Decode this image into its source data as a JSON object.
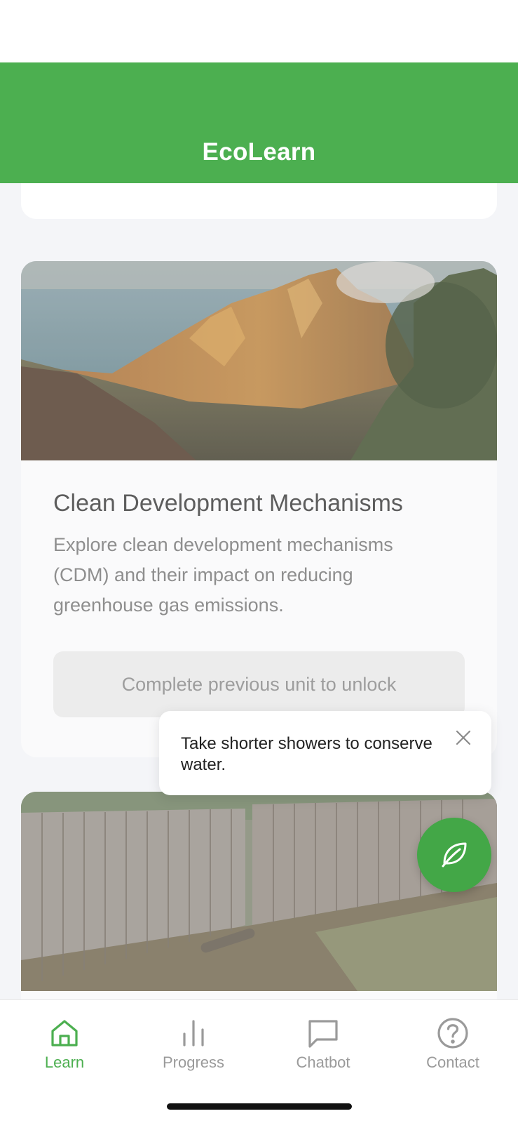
{
  "app": {
    "title": "EcoLearn",
    "brand_color": "#4caf50"
  },
  "units": [
    {
      "title": "Clean Development Mechanisms",
      "description": "Explore clean development mechanisms (CDM) and their impact on reducing greenhouse gas emissions.",
      "button_label": "Complete previous unit to unlock",
      "locked": true,
      "image": "coastal-mountain-valley"
    },
    {
      "image": "wooden-fence-yard"
    }
  ],
  "toast": {
    "message": "Take shorter showers to conserve water.",
    "close_icon": "close-icon"
  },
  "fab": {
    "icon": "leaf-icon"
  },
  "tabs": [
    {
      "label": "Learn",
      "icon": "home-icon",
      "active": true
    },
    {
      "label": "Progress",
      "icon": "bar-chart-icon",
      "active": false
    },
    {
      "label": "Chatbot",
      "icon": "chat-bubble-icon",
      "active": false
    },
    {
      "label": "Contact",
      "icon": "help-circle-icon",
      "active": false
    }
  ]
}
